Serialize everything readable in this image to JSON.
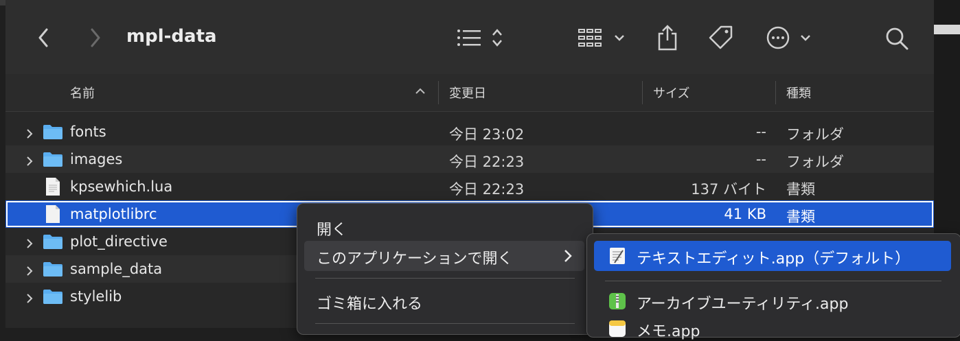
{
  "window": {
    "title": "mpl-data"
  },
  "toolbar": {
    "back_icon": "chevron-left-icon",
    "forward_icon": "chevron-right-icon",
    "view_icon": "list-view-icon",
    "group_icon": "grid-group-icon",
    "share_icon": "share-icon",
    "tag_icon": "tag-icon",
    "more_icon": "ellipsis-circle-icon",
    "search_icon": "search-icon"
  },
  "columns": {
    "name": "名前",
    "date": "変更日",
    "size": "サイズ",
    "kind": "種類"
  },
  "files": [
    {
      "name": "fonts",
      "type": "folder",
      "date": "今日 23:02",
      "size": "--",
      "kind": "フォルダ"
    },
    {
      "name": "images",
      "type": "folder",
      "date": "今日 22:23",
      "size": "--",
      "kind": "フォルダ"
    },
    {
      "name": "kpsewhich.lua",
      "type": "file",
      "date": "今日 22:23",
      "size": "137 バイト",
      "kind": "書類"
    },
    {
      "name": "matplotlibrc",
      "type": "file",
      "date": "",
      "size": "41 KB",
      "kind": "書類",
      "selected": true
    },
    {
      "name": "plot_directive",
      "type": "folder",
      "date": "",
      "size": "",
      "kind": ""
    },
    {
      "name": "sample_data",
      "type": "folder",
      "date": "",
      "size": "",
      "kind": ""
    },
    {
      "name": "stylelib",
      "type": "folder",
      "date": "",
      "size": "",
      "kind": ""
    }
  ],
  "context_menu": {
    "open": "開く",
    "open_with": "このアプリケーションで開く",
    "trash": "ゴミ箱に入れる"
  },
  "open_with_menu": {
    "default_app": "テキストエディット.app（デフォルト）",
    "archive_app": "アーカイブユーティリティ.app",
    "memo_app": "メモ.app"
  },
  "colors": {
    "accent": "#1f5bd1",
    "folder": "#5aaef0"
  }
}
